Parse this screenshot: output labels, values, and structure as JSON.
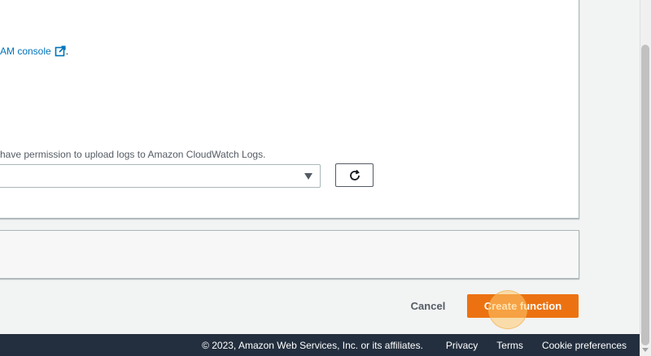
{
  "permissions": {
    "console_prefix": "AM console",
    "console_suffix": ".",
    "upload_logs_text": "have permission to upload logs to Amazon CloudWatch Logs."
  },
  "actions": {
    "cancel_label": "Cancel",
    "create_label": "Create function"
  },
  "footer": {
    "copyright": "© 2023, Amazon Web Services, Inc. or its affiliates.",
    "privacy": "Privacy",
    "terms": "Terms",
    "cookie_preferences": "Cookie preferences"
  },
  "colors": {
    "link": "#0073bb",
    "primary_button": "#ec7211",
    "footer_bg": "#232f3e"
  },
  "icons": {
    "external_link": "external-link-icon",
    "refresh": "refresh-icon",
    "dropdown": "caret-down-icon"
  }
}
